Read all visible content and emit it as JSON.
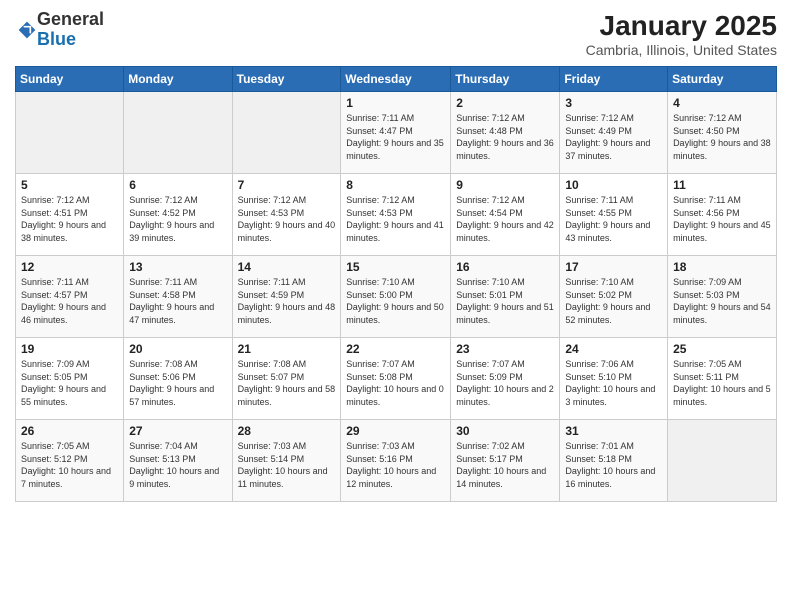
{
  "logo": {
    "general": "General",
    "blue": "Blue"
  },
  "title": "January 2025",
  "subtitle": "Cambria, Illinois, United States",
  "days_header": [
    "Sunday",
    "Monday",
    "Tuesday",
    "Wednesday",
    "Thursday",
    "Friday",
    "Saturday"
  ],
  "weeks": [
    [
      {
        "day": "",
        "info": ""
      },
      {
        "day": "",
        "info": ""
      },
      {
        "day": "",
        "info": ""
      },
      {
        "day": "1",
        "info": "Sunrise: 7:11 AM\nSunset: 4:47 PM\nDaylight: 9 hours\nand 35 minutes."
      },
      {
        "day": "2",
        "info": "Sunrise: 7:12 AM\nSunset: 4:48 PM\nDaylight: 9 hours\nand 36 minutes."
      },
      {
        "day": "3",
        "info": "Sunrise: 7:12 AM\nSunset: 4:49 PM\nDaylight: 9 hours\nand 37 minutes."
      },
      {
        "day": "4",
        "info": "Sunrise: 7:12 AM\nSunset: 4:50 PM\nDaylight: 9 hours\nand 38 minutes."
      }
    ],
    [
      {
        "day": "5",
        "info": "Sunrise: 7:12 AM\nSunset: 4:51 PM\nDaylight: 9 hours\nand 38 minutes."
      },
      {
        "day": "6",
        "info": "Sunrise: 7:12 AM\nSunset: 4:52 PM\nDaylight: 9 hours\nand 39 minutes."
      },
      {
        "day": "7",
        "info": "Sunrise: 7:12 AM\nSunset: 4:53 PM\nDaylight: 9 hours\nand 40 minutes."
      },
      {
        "day": "8",
        "info": "Sunrise: 7:12 AM\nSunset: 4:53 PM\nDaylight: 9 hours\nand 41 minutes."
      },
      {
        "day": "9",
        "info": "Sunrise: 7:12 AM\nSunset: 4:54 PM\nDaylight: 9 hours\nand 42 minutes."
      },
      {
        "day": "10",
        "info": "Sunrise: 7:11 AM\nSunset: 4:55 PM\nDaylight: 9 hours\nand 43 minutes."
      },
      {
        "day": "11",
        "info": "Sunrise: 7:11 AM\nSunset: 4:56 PM\nDaylight: 9 hours\nand 45 minutes."
      }
    ],
    [
      {
        "day": "12",
        "info": "Sunrise: 7:11 AM\nSunset: 4:57 PM\nDaylight: 9 hours\nand 46 minutes."
      },
      {
        "day": "13",
        "info": "Sunrise: 7:11 AM\nSunset: 4:58 PM\nDaylight: 9 hours\nand 47 minutes."
      },
      {
        "day": "14",
        "info": "Sunrise: 7:11 AM\nSunset: 4:59 PM\nDaylight: 9 hours\nand 48 minutes."
      },
      {
        "day": "15",
        "info": "Sunrise: 7:10 AM\nSunset: 5:00 PM\nDaylight: 9 hours\nand 50 minutes."
      },
      {
        "day": "16",
        "info": "Sunrise: 7:10 AM\nSunset: 5:01 PM\nDaylight: 9 hours\nand 51 minutes."
      },
      {
        "day": "17",
        "info": "Sunrise: 7:10 AM\nSunset: 5:02 PM\nDaylight: 9 hours\nand 52 minutes."
      },
      {
        "day": "18",
        "info": "Sunrise: 7:09 AM\nSunset: 5:03 PM\nDaylight: 9 hours\nand 54 minutes."
      }
    ],
    [
      {
        "day": "19",
        "info": "Sunrise: 7:09 AM\nSunset: 5:05 PM\nDaylight: 9 hours\nand 55 minutes."
      },
      {
        "day": "20",
        "info": "Sunrise: 7:08 AM\nSunset: 5:06 PM\nDaylight: 9 hours\nand 57 minutes."
      },
      {
        "day": "21",
        "info": "Sunrise: 7:08 AM\nSunset: 5:07 PM\nDaylight: 9 hours\nand 58 minutes."
      },
      {
        "day": "22",
        "info": "Sunrise: 7:07 AM\nSunset: 5:08 PM\nDaylight: 10 hours\nand 0 minutes."
      },
      {
        "day": "23",
        "info": "Sunrise: 7:07 AM\nSunset: 5:09 PM\nDaylight: 10 hours\nand 2 minutes."
      },
      {
        "day": "24",
        "info": "Sunrise: 7:06 AM\nSunset: 5:10 PM\nDaylight: 10 hours\nand 3 minutes."
      },
      {
        "day": "25",
        "info": "Sunrise: 7:05 AM\nSunset: 5:11 PM\nDaylight: 10 hours\nand 5 minutes."
      }
    ],
    [
      {
        "day": "26",
        "info": "Sunrise: 7:05 AM\nSunset: 5:12 PM\nDaylight: 10 hours\nand 7 minutes."
      },
      {
        "day": "27",
        "info": "Sunrise: 7:04 AM\nSunset: 5:13 PM\nDaylight: 10 hours\nand 9 minutes."
      },
      {
        "day": "28",
        "info": "Sunrise: 7:03 AM\nSunset: 5:14 PM\nDaylight: 10 hours\nand 11 minutes."
      },
      {
        "day": "29",
        "info": "Sunrise: 7:03 AM\nSunset: 5:16 PM\nDaylight: 10 hours\nand 12 minutes."
      },
      {
        "day": "30",
        "info": "Sunrise: 7:02 AM\nSunset: 5:17 PM\nDaylight: 10 hours\nand 14 minutes."
      },
      {
        "day": "31",
        "info": "Sunrise: 7:01 AM\nSunset: 5:18 PM\nDaylight: 10 hours\nand 16 minutes."
      },
      {
        "day": "",
        "info": ""
      }
    ]
  ]
}
